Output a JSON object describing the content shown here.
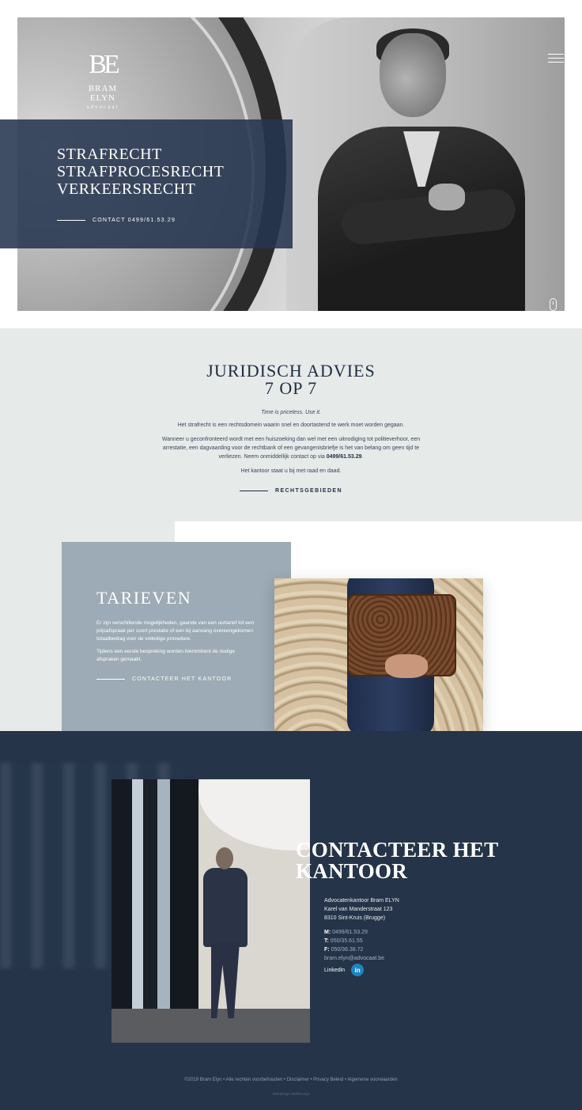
{
  "brand": {
    "monogram": "BE",
    "name": "BRAM ELYN",
    "tagline": "advocaat"
  },
  "hero": {
    "areas": [
      "STRAFRECHT",
      "STRAFPROCESRECHT",
      "VERKEERSRECHT"
    ],
    "contact_label": "CONTACT 0499/61.53.29"
  },
  "advies": {
    "title_line1": "JURIDISCH ADVIES",
    "title_line2": "7 OP 7",
    "tagline": "Time is priceless. Use it.",
    "p1": "Het strafrecht is een rechtsdomein waarin snel en doortastend te werk moet worden gegaan.",
    "p2": "Wanneer u  geconfronteerd wordt met een huiszoeking dan wel met een uitnodiging tot politieverhoor, een arrestatie, een dagvaarding voor de rechtbank of een gevangenisbriefje  is het van belang om geen tijd te verliezen. Neem onmiddellijk contact op via ",
    "p2_phone": "0499/61.53.29",
    "p2_end": ".",
    "p3": "Het kantoor staat u bij met raad en daad.",
    "cta": "RECHTSGEBIEDEN"
  },
  "tarieven": {
    "title": "TARIEVEN",
    "p1": "Er zijn verschillende mogelijkheden, gaande van een uurtarief tot een prijsafspraak per soort prestatie of een bij aanvang overeengekomen totaalbedrag voor de volledige procedure.",
    "p2": "Tijdens een eerste bespreking worden hieromtrent de nodige afspraken gemaakt.",
    "cta": "CONTACTEER HET KANTOOR"
  },
  "contact": {
    "title_line1": "CONTACTEER HET",
    "title_line2": "KANTOOR",
    "office": "Advocatenkantoor Bram ELYN",
    "street": "Karel van Manderstraat 123",
    "city": "8310 Sint-Kruis (Brugge)",
    "mobile_label": "M:",
    "mobile": "0499/61.53.29",
    "tel_label": "T:",
    "tel": "050/35.61.55",
    "fax_label": "F:",
    "fax": "050/36.38.72",
    "email": "bram.elyn@advocaat.be",
    "linkedin_label": "Linkedin",
    "linkedin_icon": "in"
  },
  "footer": {
    "copyright": "©2019 Bram Elyn",
    "links": [
      "Alle rechten voorbehouden",
      "Disclaimer",
      "Privacy Beleid",
      "Algemene voorwaarden"
    ],
    "separator": " • ",
    "credit": "Webdesign Webbourgo"
  }
}
